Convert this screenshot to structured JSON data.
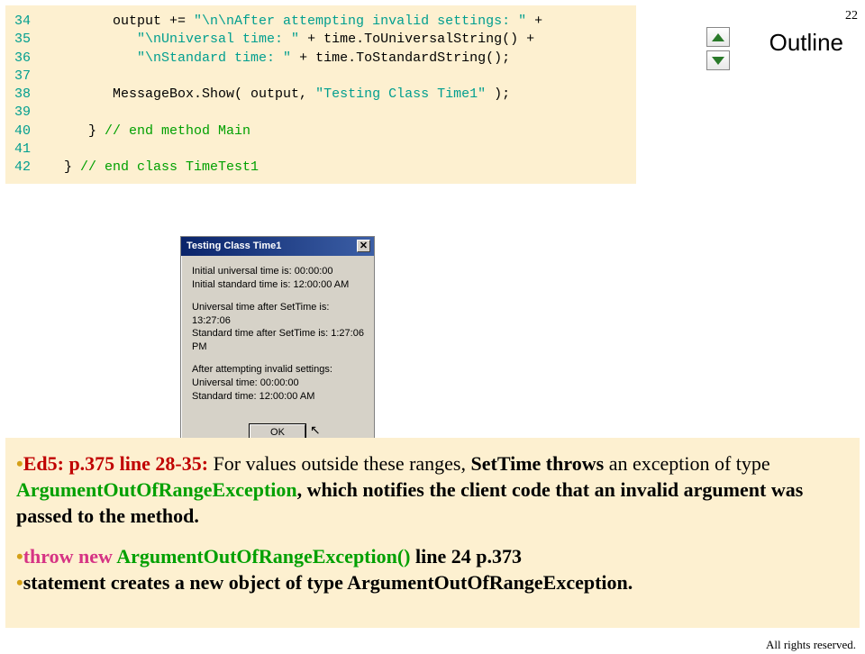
{
  "page_number": "22",
  "outline_label": "Outline",
  "code": {
    "l34": {
      "n": "34",
      "pre": "         output += ",
      "str": "\"\\n\\nAfter attempting invalid settings: \"",
      "post": " +"
    },
    "l35": {
      "n": "35",
      "pre": "            ",
      "str": "\"\\nUniversal time: \"",
      "post": " + time.ToUniversalString() +"
    },
    "l36": {
      "n": "36",
      "pre": "            ",
      "str": "\"\\nStandard time: \"",
      "post": " + time.ToStandardString();"
    },
    "l37": {
      "n": "37",
      "body": ""
    },
    "l38": {
      "n": "38",
      "pre": "         MessageBox.Show( output, ",
      "str": "\"Testing Class Time1\"",
      "post": " );"
    },
    "l39": {
      "n": "39",
      "body": ""
    },
    "l40": {
      "n": "40",
      "pre": "      } ",
      "comment": "// end method Main"
    },
    "l41": {
      "n": "41",
      "body": ""
    },
    "l42": {
      "n": "42",
      "pre": "   } ",
      "comment": "// end class TimeTest1"
    }
  },
  "msgbox": {
    "title": "Testing Class Time1",
    "p1": "Initial universal time is: 00:00:00\nInitial standard time is: 12:00:00 AM",
    "p2": "Universal time after SetTime is: 13:27:06\nStandard time after SetTime is: 1:27:06 PM",
    "p3": "After attempting invalid settings:\nUniversal time: 00:00:00\nStandard time: 12:00:00 AM",
    "ok": "OK"
  },
  "notes": {
    "n1a": "Ed5: p.375 line 28-35:",
    "n1b": " For values outside these ranges, ",
    "n1c": "SetTime throws",
    "n1d": " an exception of type ",
    "n1e": "ArgumentOutOfRangeException",
    "n1f": ", which notifies the client code that an invalid argument was passed to the method.",
    "n2a": "throw new ",
    "n2b": "ArgumentOutOfRangeException() ",
    "n2c": "line 24 p.373",
    "n3a": "statement creates a new object of type ArgumentOutOfRangeException."
  },
  "footer": "All rights reserved."
}
